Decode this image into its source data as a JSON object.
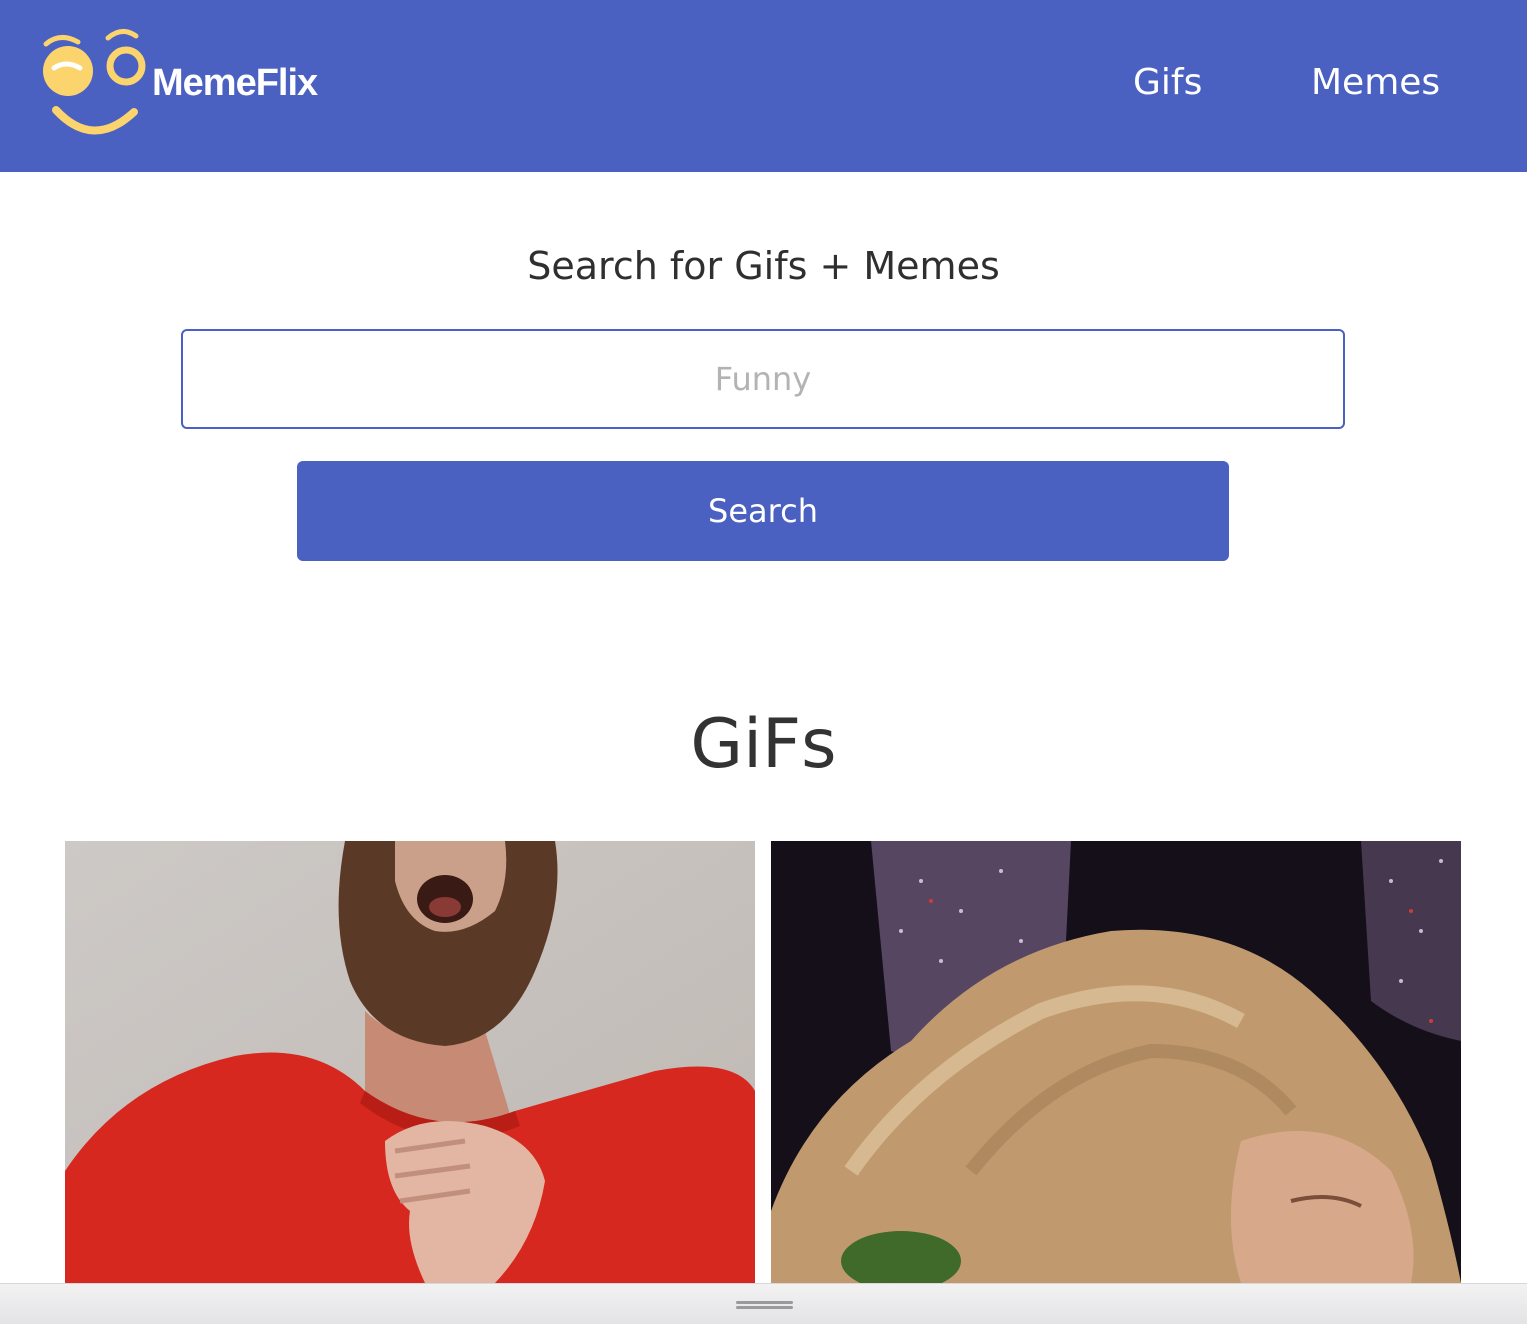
{
  "navbar": {
    "brand": "MemeFlix",
    "links": [
      {
        "label": "Gifs"
      },
      {
        "label": "Memes"
      }
    ],
    "background_color": "#4b61c1",
    "logo_color": "#fbd46d"
  },
  "search": {
    "heading": "Search for Gifs + Memes",
    "placeholder": "Funny",
    "value": "",
    "button_label": "Search"
  },
  "gifs_section": {
    "heading": "GiFs",
    "items": [
      {
        "icon": "laughing-man-gif-image"
      },
      {
        "icon": "blonde-woman-gif-image"
      }
    ]
  }
}
